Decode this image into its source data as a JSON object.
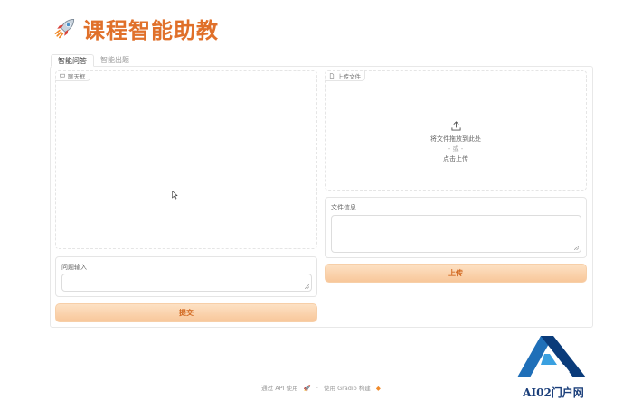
{
  "header": {
    "title": "课程智能助教",
    "rocket_icon": "rocket-icon",
    "title_color": "#e0702a"
  },
  "tabs": [
    {
      "label": "智能问答",
      "active": true
    },
    {
      "label": "智能出题",
      "active": false
    }
  ],
  "chatbot": {
    "label": "聊天框"
  },
  "question": {
    "label": "问题输入",
    "value": "",
    "placeholder": ""
  },
  "submit": {
    "label": "提交"
  },
  "upload_area": {
    "label": "上传文件",
    "drop_text": "将文件拖放到此处",
    "or_text": "- 或 -",
    "click_text": "点击上传"
  },
  "file_info": {
    "label": "文件信息",
    "value": ""
  },
  "upload_button": {
    "label": "上传"
  },
  "footer": {
    "api_text": "通过 API 使用",
    "separator": "·",
    "built_text": "使用 Gradio 构建"
  },
  "watermark": {
    "text": "AI02门户网"
  },
  "colors": {
    "accent": "#e0702a",
    "button_bg": "#f8c79a",
    "button_text": "#d26a22"
  }
}
